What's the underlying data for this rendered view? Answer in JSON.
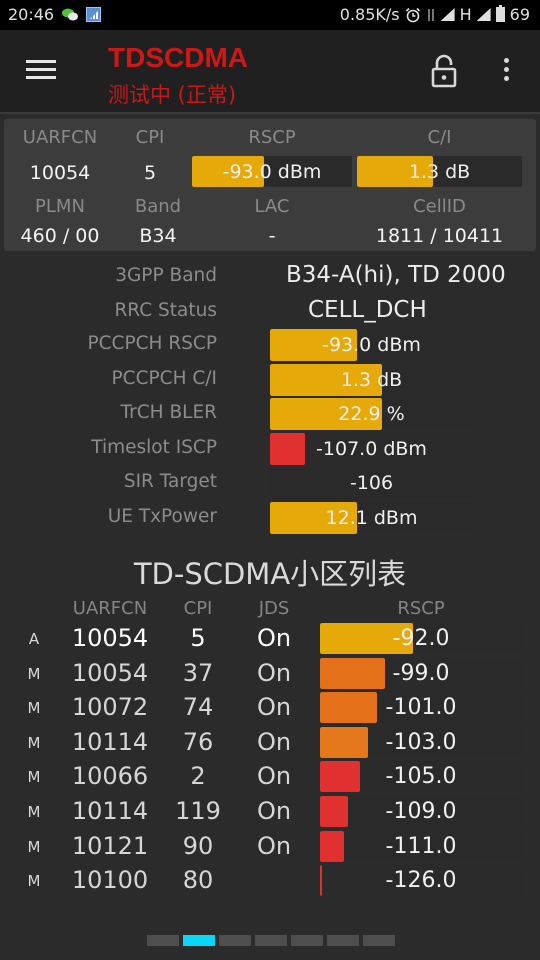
{
  "status_bar": {
    "time": "20:46",
    "left_icons": [
      "wechat-icon",
      "signal-app-icon"
    ],
    "net_speed": "0.85K/s",
    "right_icons": [
      "alarm-icon",
      "data-activity-icon",
      "signal-icon",
      "network-type-icon",
      "signal-icon-2",
      "battery-icon"
    ],
    "network_type": "H",
    "battery": "69"
  },
  "app_bar": {
    "title": "TDSCDMA",
    "subtitle": "测试中 (正常)",
    "icons": [
      "menu-icon",
      "lock-open-icon",
      "more-vert-icon"
    ]
  },
  "summary": {
    "labels": {
      "uarfcn": "UARFCN",
      "cpi": "CPI",
      "rscp": "RSCP",
      "ci": "C/I",
      "plmn": "PLMN",
      "band": "Band",
      "lac": "LAC",
      "cellid": "CellID"
    },
    "uarfcn": "10054",
    "cpi": "5",
    "rscp": {
      "text": "-93.0 dBm",
      "fill": 0.45,
      "color": "#e6a90a"
    },
    "ci": {
      "text": "1.3 dB",
      "fill": 0.46,
      "color": "#e6a90a"
    },
    "plmn": "460 / 00",
    "band": "B34",
    "lac": "-",
    "cellid": "1811 / 10411"
  },
  "details": {
    "band_label": "3GPP Band",
    "band_value": "B34-A(hi), TD 2000",
    "rrc_label": "RRC Status",
    "rrc_value": "CELL_DCH",
    "metrics": [
      {
        "label": "PCCPCH RSCP",
        "text": "-93.0 dBm",
        "fill": 0.43,
        "color": "#e6a90a"
      },
      {
        "label": "PCCPCH C/I",
        "text": "1.3 dB",
        "fill": 0.55,
        "color": "#e6a90a"
      },
      {
        "label": "TrCH BLER",
        "text": "22.9 %",
        "fill": 0.55,
        "color": "#e6a90a"
      },
      {
        "label": "Timeslot ISCP",
        "text": "-107.0 dBm",
        "fill": 0.17,
        "color": "#e03030"
      },
      {
        "label": "SIR Target",
        "text": "-106",
        "fill": 0,
        "color": "#e6a90a"
      },
      {
        "label": "UE TxPower",
        "text": "12.1 dBm",
        "fill": 0.43,
        "color": "#e6a90a"
      }
    ]
  },
  "cell_list": {
    "title": "TD-SCDMA小区列表",
    "headers": {
      "uarfcn": "UARFCN",
      "cpi": "CPI",
      "jds": "JDS",
      "rscp": "RSCP"
    },
    "rows": [
      {
        "type": "A",
        "uarfcn": "10054",
        "cpi": "5",
        "jds": "On",
        "rscp": "-92.0",
        "fill": 0.46,
        "color": "#e6a90a"
      },
      {
        "type": "M",
        "uarfcn": "10054",
        "cpi": "37",
        "jds": "On",
        "rscp": "-99.0",
        "fill": 0.32,
        "color": "#e4701a"
      },
      {
        "type": "M",
        "uarfcn": "10072",
        "cpi": "74",
        "jds": "On",
        "rscp": "-101.0",
        "fill": 0.28,
        "color": "#e4701a"
      },
      {
        "type": "M",
        "uarfcn": "10114",
        "cpi": "76",
        "jds": "On",
        "rscp": "-103.0",
        "fill": 0.24,
        "color": "#e4781a"
      },
      {
        "type": "M",
        "uarfcn": "10066",
        "cpi": "2",
        "jds": "On",
        "rscp": "-105.0",
        "fill": 0.2,
        "color": "#e03030"
      },
      {
        "type": "M",
        "uarfcn": "10114",
        "cpi": "119",
        "jds": "On",
        "rscp": "-109.0",
        "fill": 0.14,
        "color": "#e03030"
      },
      {
        "type": "M",
        "uarfcn": "10121",
        "cpi": "90",
        "jds": "On",
        "rscp": "-111.0",
        "fill": 0.12,
        "color": "#e03030"
      },
      {
        "type": "M",
        "uarfcn": "10100",
        "cpi": "80",
        "jds": "",
        "rscp": "-126.0",
        "fill": 0.01,
        "color": "#e03030"
      }
    ]
  },
  "pager": {
    "count": 7,
    "active_index": 1
  }
}
